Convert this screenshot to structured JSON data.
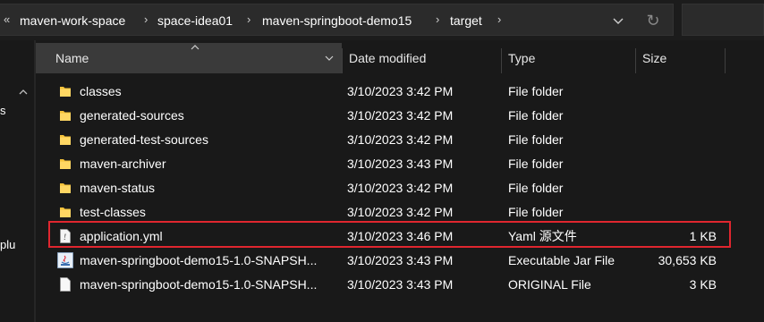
{
  "address": {
    "more": "«",
    "crumbs": [
      "maven-work-space",
      "space-idea01",
      "maven-springboot-demo15",
      "target"
    ],
    "separator": "›",
    "refresh_glyph": "↻"
  },
  "nav": {
    "fragments": [
      "s",
      "plu"
    ]
  },
  "columns": {
    "name": "Name",
    "date": "Date modified",
    "type": "Type",
    "size": "Size"
  },
  "rows": [
    {
      "name": "classes",
      "date": "3/10/2023 3:42 PM",
      "type": "File folder",
      "size": "",
      "icon": "folder-icon"
    },
    {
      "name": "generated-sources",
      "date": "3/10/2023 3:42 PM",
      "type": "File folder",
      "size": "",
      "icon": "folder-icon"
    },
    {
      "name": "generated-test-sources",
      "date": "3/10/2023 3:42 PM",
      "type": "File folder",
      "size": "",
      "icon": "folder-icon"
    },
    {
      "name": "maven-archiver",
      "date": "3/10/2023 3:43 PM",
      "type": "File folder",
      "size": "",
      "icon": "folder-icon"
    },
    {
      "name": "maven-status",
      "date": "3/10/2023 3:42 PM",
      "type": "File folder",
      "size": "",
      "icon": "folder-icon"
    },
    {
      "name": "test-classes",
      "date": "3/10/2023 3:42 PM",
      "type": "File folder",
      "size": "",
      "icon": "folder-icon"
    },
    {
      "name": "application.yml",
      "date": "3/10/2023 3:46 PM",
      "type": "Yaml 源文件",
      "size": "1 KB",
      "icon": "yaml-file-icon"
    },
    {
      "name": "maven-springboot-demo15-1.0-SNAPSH...",
      "date": "3/10/2023 3:43 PM",
      "type": "Executable Jar File",
      "size": "30,653 KB",
      "icon": "java-jar-icon"
    },
    {
      "name": "maven-springboot-demo15-1.0-SNAPSH...",
      "date": "3/10/2023 3:43 PM",
      "type": "ORIGINAL File",
      "size": "3 KB",
      "icon": "blank-file-icon"
    }
  ],
  "colors": {
    "background": "#191919",
    "folder": "#f4c23a",
    "highlight": "#e0262f"
  }
}
